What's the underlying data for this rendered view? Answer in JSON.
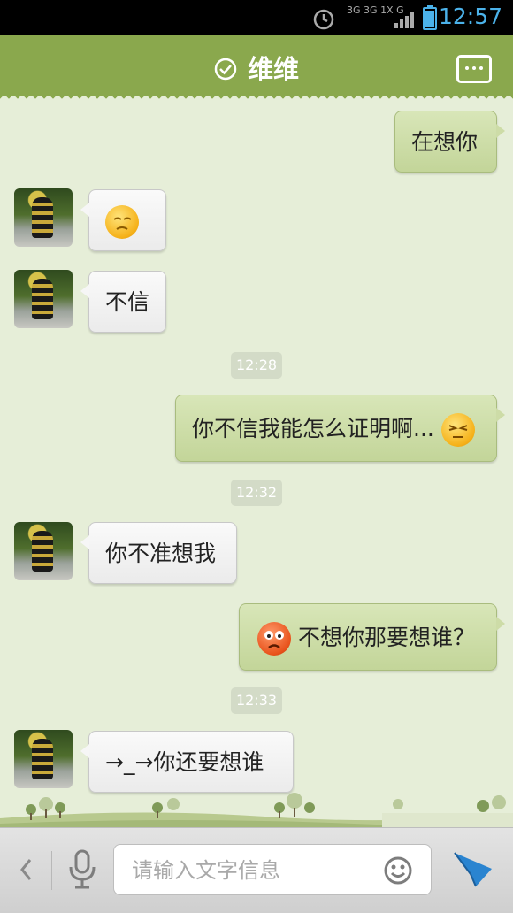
{
  "status_bar": {
    "time": "12:57",
    "network_labels": [
      "3G",
      "3G",
      "1X",
      "G"
    ]
  },
  "header": {
    "contact_name": "维维"
  },
  "messages": [
    {
      "side": "right",
      "text": "在想你"
    },
    {
      "side": "left",
      "text": "",
      "emoji": "sad-emoji"
    },
    {
      "side": "left",
      "text": "不信"
    },
    {
      "side": "time",
      "text": "12:28"
    },
    {
      "side": "right",
      "text": "你不信我能怎么证明啊...",
      "emoji": "squint-emoji"
    },
    {
      "side": "time",
      "text": "12:32"
    },
    {
      "side": "left",
      "text": "你不准想我"
    },
    {
      "side": "right",
      "text": "不想你那要想谁？",
      "emoji": "angry-emoji"
    },
    {
      "side": "time",
      "text": "12:33"
    },
    {
      "side": "left",
      "text": "→_→你还要想谁"
    }
  ],
  "input_bar": {
    "placeholder": "请输入文字信息"
  },
  "colors": {
    "header": "#8aa84d",
    "chat_bg": "#e6eed8",
    "sent_bubble": "#c9daa3",
    "received_bubble": "#f4f4f4",
    "send_icon": "#2a84d0"
  }
}
